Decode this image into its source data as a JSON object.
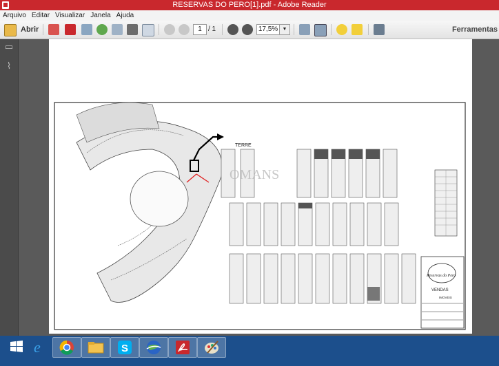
{
  "window": {
    "title": "RESERVAS DO PERO[1].pdf - Adobe Reader"
  },
  "menu": [
    "Arquivo",
    "Editar",
    "Visualizar",
    "Janela",
    "Ajuda"
  ],
  "toolbar": {
    "open_label": "Abrir",
    "page_current": "1",
    "page_total": "/ 1",
    "zoom": "17,5%",
    "tools_label": "Ferramentas"
  },
  "document": {
    "map_label": "TERRE",
    "watermark": "OMANS",
    "logo_text": "Reservas do Pero",
    "logo_sub": "VENDAS",
    "agency": "IMOVEIS"
  },
  "colors": {
    "titlebar": "#c9282d",
    "taskbar": "#1c4f8c",
    "doc_background": "#5a5a5a"
  },
  "taskbar_apps": [
    "start-windows-icon",
    "internet-explorer-icon",
    "chrome-icon",
    "file-explorer-icon",
    "skype-icon",
    "google-earth-icon",
    "adobe-reader-icon",
    "paint-icon"
  ]
}
